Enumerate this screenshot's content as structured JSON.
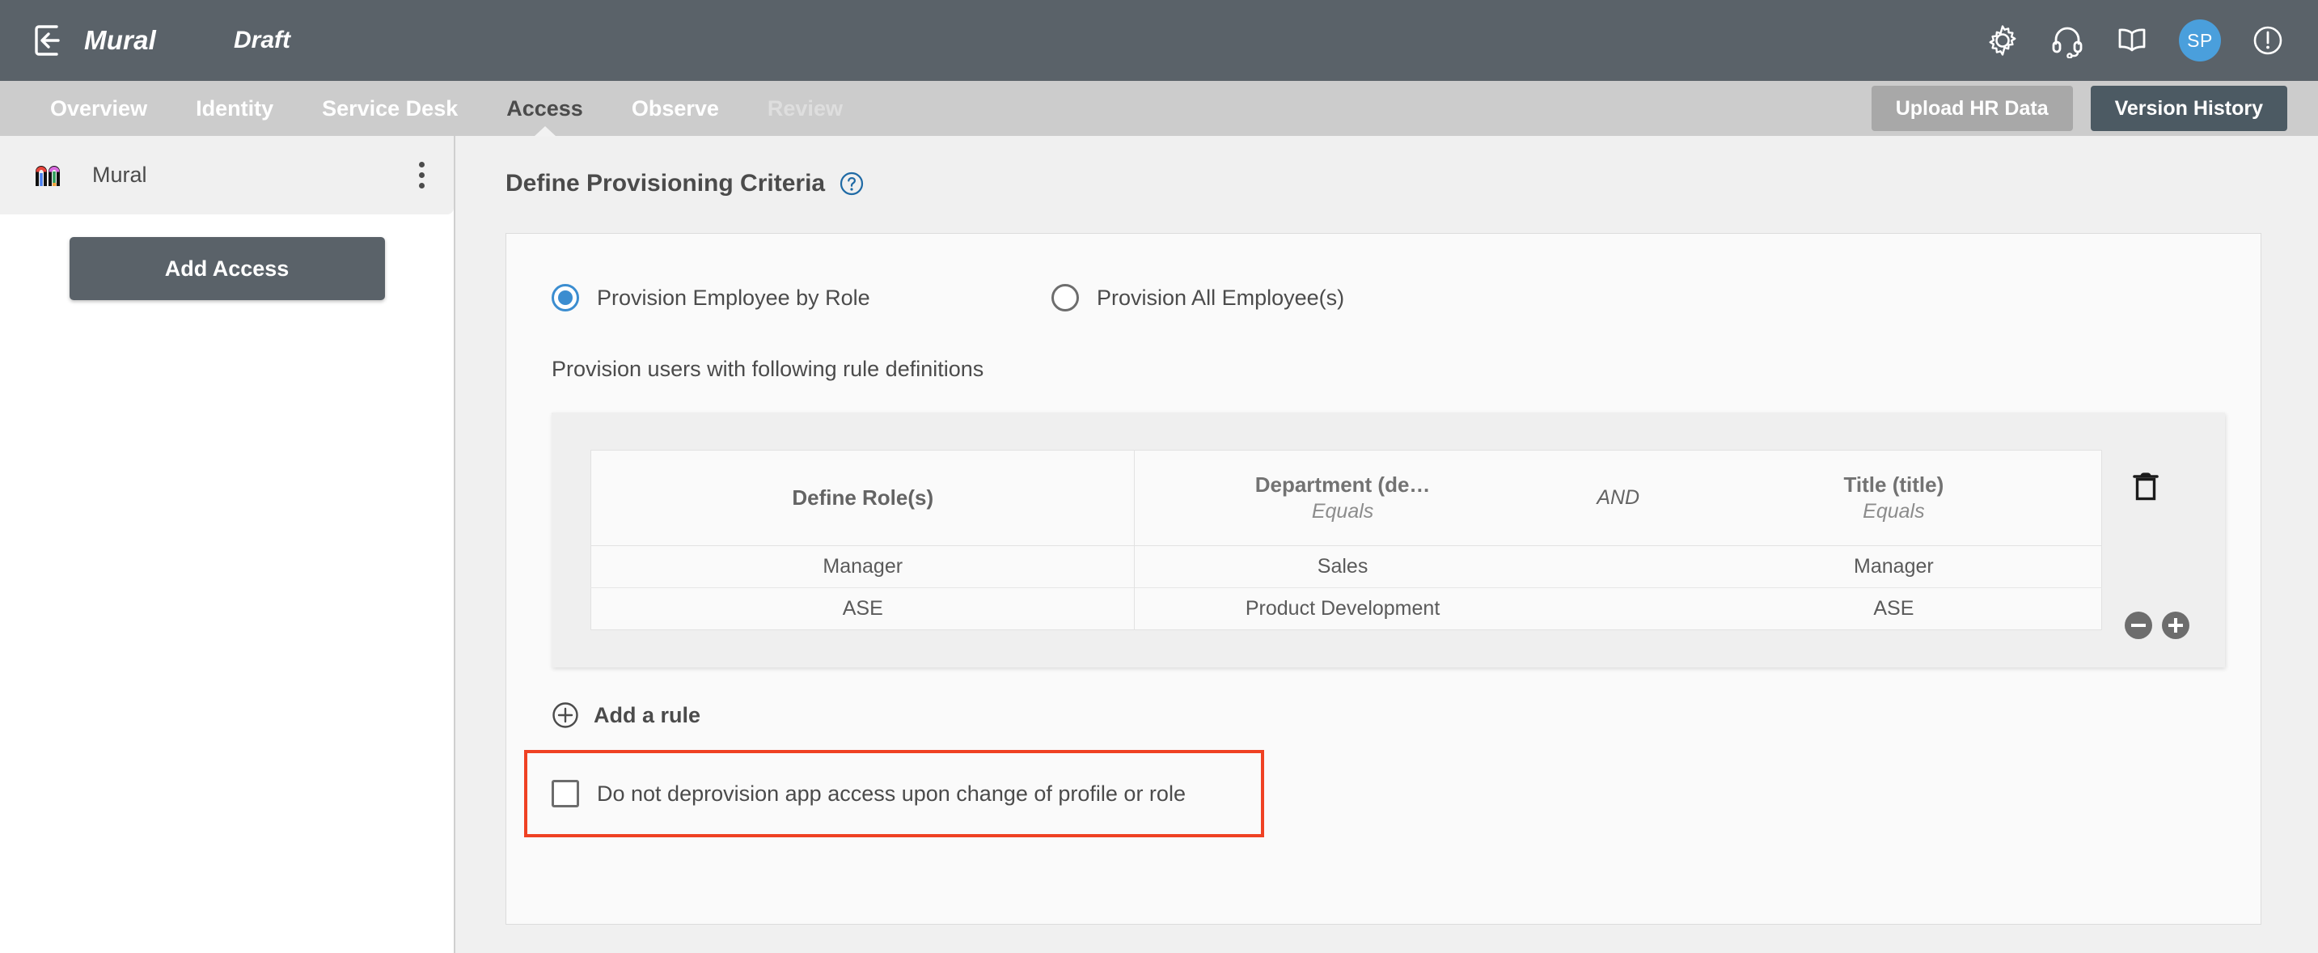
{
  "topbar": {
    "back_icon": "back-arrow-icon",
    "app_title": "Mural",
    "status": "Draft",
    "icons": [
      {
        "name": "gear-icon"
      },
      {
        "name": "headset-icon"
      },
      {
        "name": "book-icon"
      }
    ],
    "avatar_initials": "SP",
    "alert_icon": "alert-circle-icon",
    "accent_avatar_color": "#4a9fdc",
    "background_color": "#5a6269"
  },
  "navbar": {
    "tabs": [
      {
        "label": "Overview",
        "state": "normal"
      },
      {
        "label": "Identity",
        "state": "normal"
      },
      {
        "label": "Service Desk",
        "state": "normal"
      },
      {
        "label": "Access",
        "state": "active"
      },
      {
        "label": "Observe",
        "state": "normal"
      },
      {
        "label": "Review",
        "state": "disabled"
      }
    ],
    "upload_button": "Upload HR Data",
    "version_button": "Version History",
    "background_color": "#cccccc"
  },
  "sidebar": {
    "app_item": {
      "logo": "mural-logo-icon",
      "label": "Mural",
      "menu_icon": "kebab-menu-icon"
    },
    "add_access_button": "Add Access"
  },
  "main": {
    "section_title": "Define Provisioning Criteria",
    "help_icon": "help-circle-icon",
    "radio_options": [
      {
        "label": "Provision Employee by Role",
        "selected": true
      },
      {
        "label": "Provision All Employee(s)",
        "selected": false
      }
    ],
    "rule_intro": "Provision users with following rule definitions",
    "rule_table": {
      "headers": {
        "role": "Define Role(s)",
        "department_name": "Department (de…",
        "department_op": "Equals",
        "conjunction": "AND",
        "title_name": "Title (title)",
        "title_op": "Equals"
      },
      "rows": [
        {
          "role": "Manager",
          "department": "Sales",
          "title": "Manager"
        },
        {
          "role": "ASE",
          "department": "Product Development",
          "title": "ASE"
        }
      ]
    },
    "delete_icon": "trash-icon",
    "row_minus_icon": "minus-circle-icon",
    "row_plus_icon": "plus-circle-icon",
    "add_rule": {
      "icon": "plus-circle-outline-icon",
      "label": "Add a rule"
    },
    "deprovision_checkbox": {
      "label": "Do not deprovision app access upon change of profile or role",
      "checked": false,
      "highlight_color": "#ef4123"
    }
  }
}
